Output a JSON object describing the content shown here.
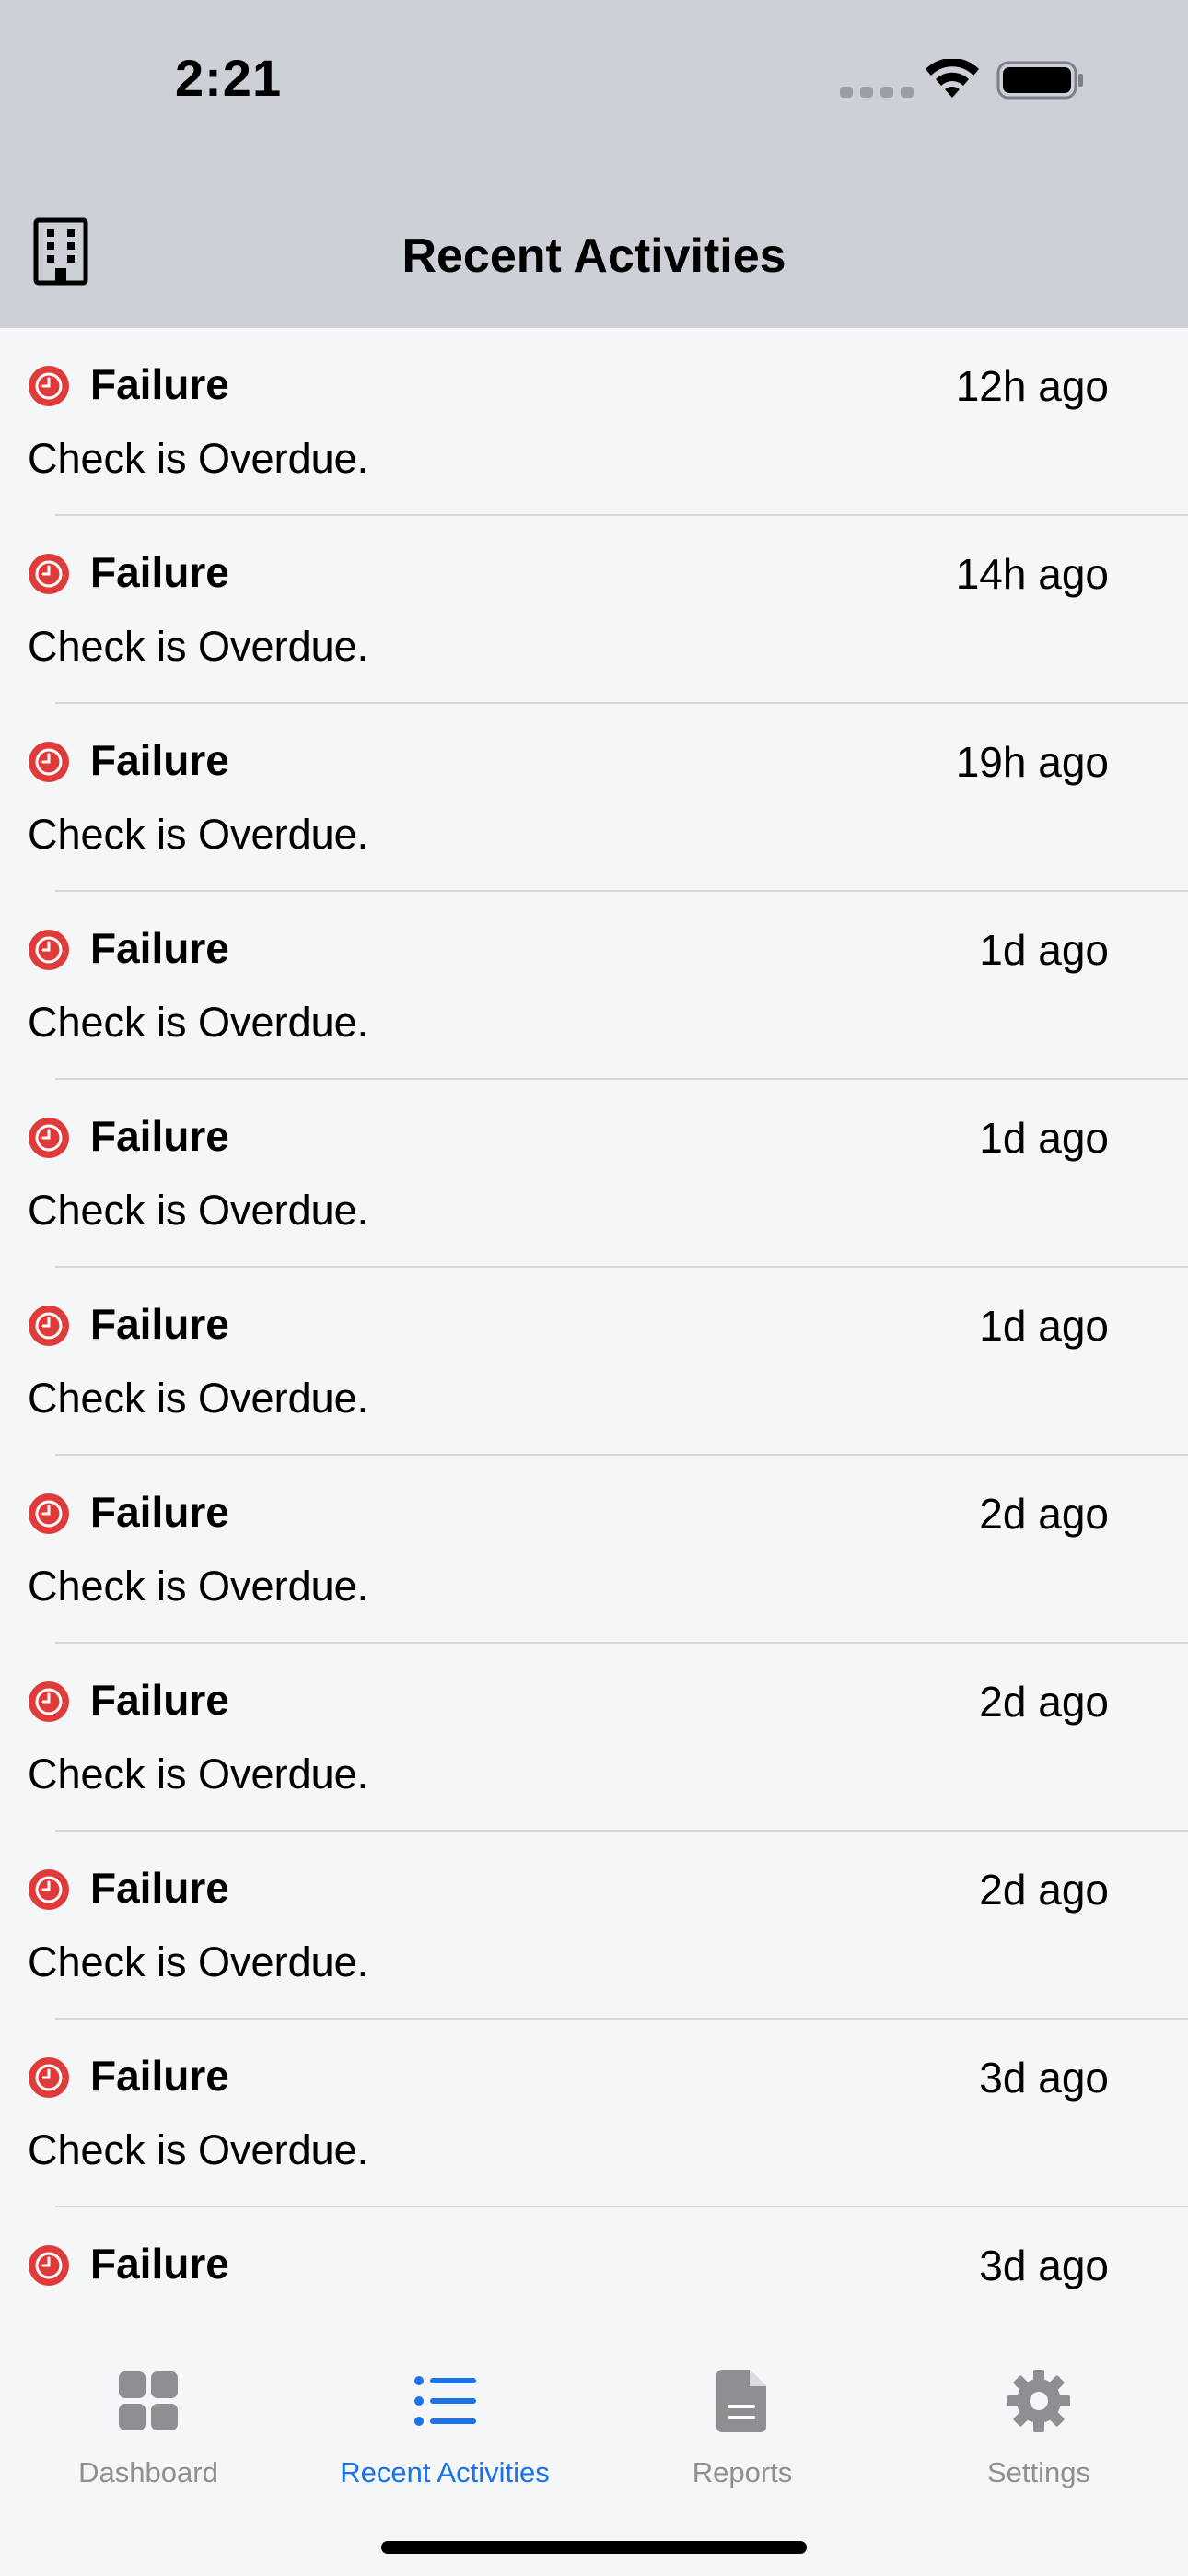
{
  "status_bar": {
    "time": "2:21"
  },
  "header": {
    "title": "Recent Activities",
    "left_icon": "building-icon"
  },
  "colors": {
    "accent": "#1a73e8",
    "failure": "#e03b3b",
    "header_bg": "#cdd1d7",
    "inactive": "#8e8e93"
  },
  "activities": [
    {
      "title": "Failure",
      "time": "12h ago",
      "description": "Check is Overdue."
    },
    {
      "title": "Failure",
      "time": "14h ago",
      "description": "Check is Overdue."
    },
    {
      "title": "Failure",
      "time": "19h ago",
      "description": "Check is Overdue."
    },
    {
      "title": "Failure",
      "time": "1d ago",
      "description": "Check is Overdue."
    },
    {
      "title": "Failure",
      "time": "1d ago",
      "description": "Check is Overdue."
    },
    {
      "title": "Failure",
      "time": "1d ago",
      "description": "Check is Overdue."
    },
    {
      "title": "Failure",
      "time": "2d ago",
      "description": "Check is Overdue."
    },
    {
      "title": "Failure",
      "time": "2d ago",
      "description": "Check is Overdue."
    },
    {
      "title": "Failure",
      "time": "2d ago",
      "description": "Check is Overdue."
    },
    {
      "title": "Failure",
      "time": "3d ago",
      "description": "Check is Overdue."
    },
    {
      "title": "Failure",
      "time": "3d ago",
      "description": ""
    }
  ],
  "tabs": [
    {
      "label": "Dashboard",
      "icon": "grid-icon",
      "active": false
    },
    {
      "label": "Recent Activities",
      "icon": "list-icon",
      "active": true
    },
    {
      "label": "Reports",
      "icon": "document-icon",
      "active": false
    },
    {
      "label": "Settings",
      "icon": "gear-icon",
      "active": false
    }
  ]
}
